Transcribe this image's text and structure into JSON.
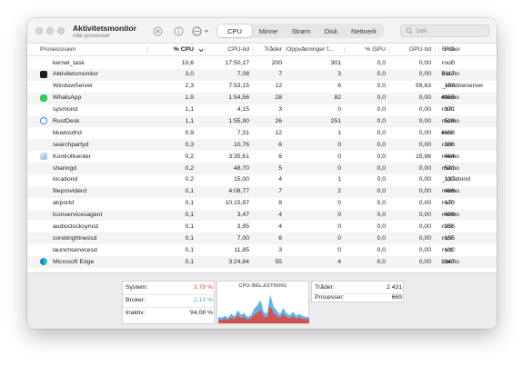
{
  "window": {
    "title": "Aktivitetsmonitor",
    "subtitle": "Alle prosesser"
  },
  "toolbar": {
    "stop_icon": "x-circle-icon",
    "info_icon": "info-icon",
    "more_icon": "ellipsis-circle-icon"
  },
  "tabs": [
    {
      "label": "CPU",
      "active": true
    },
    {
      "label": "Minne",
      "active": false
    },
    {
      "label": "Strøm",
      "active": false
    },
    {
      "label": "Disk",
      "active": false
    },
    {
      "label": "Nettverk",
      "active": false
    }
  ],
  "search": {
    "placeholder": "Søk",
    "value": ""
  },
  "columns": {
    "name": "Prosessnavn",
    "cpu": "% CPU",
    "cpu_time": "CPU-tid",
    "threads": "Tråder",
    "wakeups": "Oppvåkninger f...",
    "gpu": "% GPU",
    "gpu_time": "GPU-tid",
    "pid": "PID",
    "user": "Bruker"
  },
  "processes": [
    {
      "name": "kernel_task",
      "icon": "",
      "cpu": "10,6",
      "cpu_time": "17:50,17",
      "threads": "200",
      "wakeups": "301",
      "gpu": "0,0",
      "gpu_time": "0,00",
      "pid": "0",
      "user": "root"
    },
    {
      "name": "Aktivitetsmonitor",
      "icon": "activity-monitor-app-icon",
      "cpu": "3,0",
      "cpu_time": "7,08",
      "threads": "7",
      "wakeups": "3",
      "gpu": "0,0",
      "gpu_time": "0,00",
      "pid": "5117",
      "user": "memo"
    },
    {
      "name": "WindowServer",
      "icon": "",
      "cpu": "2,3",
      "cpu_time": "7:53,15",
      "threads": "12",
      "wakeups": "6",
      "gpu": "0,0",
      "gpu_time": "59,63",
      "pid": "159",
      "user": "_windowserver"
    },
    {
      "name": "WhatsApp",
      "icon": "whatsapp-app-icon",
      "cpu": "1,9",
      "cpu_time": "1:54,56",
      "threads": "28",
      "wakeups": "82",
      "gpu": "0,0",
      "gpu_time": "0,00",
      "pid": "4955",
      "user": "memo"
    },
    {
      "name": "sysmond",
      "icon": "",
      "cpu": "1,1",
      "cpu_time": "4,15",
      "threads": "3",
      "wakeups": "0",
      "gpu": "0,0",
      "gpu_time": "0,00",
      "pid": "371",
      "user": "root"
    },
    {
      "name": "RustDesk",
      "icon": "rustdesk-app-icon",
      "cpu": "1,1",
      "cpu_time": "1:55,90",
      "threads": "26",
      "wakeups": "251",
      "gpu": "0,0",
      "gpu_time": "0,00",
      "pid": "528",
      "user": "memo"
    },
    {
      "name": "bluetoothd",
      "icon": "",
      "cpu": "0,9",
      "cpu_time": "7,31",
      "threads": "12",
      "wakeups": "1",
      "gpu": "0,0",
      "gpu_time": "0,00",
      "pid": "4668",
      "user": "root"
    },
    {
      "name": "searchpartyd",
      "icon": "",
      "cpu": "0,3",
      "cpu_time": "10,76",
      "threads": "6",
      "wakeups": "0",
      "gpu": "0,0",
      "gpu_time": "0,00",
      "pid": "286",
      "user": "root"
    },
    {
      "name": "Kontrollsenter",
      "icon": "control-center-app-icon",
      "cpu": "0,2",
      "cpu_time": "3:35,61",
      "threads": "6",
      "wakeups": "0",
      "gpu": "0,0",
      "gpu_time": "15,96",
      "pid": "464",
      "user": "memo"
    },
    {
      "name": "sharingd",
      "icon": "",
      "cpu": "0,2",
      "cpu_time": "48,70",
      "threads": "5",
      "wakeups": "0",
      "gpu": "0,0",
      "gpu_time": "0,00",
      "pid": "531",
      "user": "memo"
    },
    {
      "name": "locationd",
      "icon": "",
      "cpu": "0,2",
      "cpu_time": "15,00",
      "threads": "4",
      "wakeups": "1",
      "gpu": "0,0",
      "gpu_time": "0,00",
      "pid": "137",
      "user": "_locationd"
    },
    {
      "name": "fileproviderd",
      "icon": "",
      "cpu": "0,1",
      "cpu_time": "4:08,77",
      "threads": "7",
      "wakeups": "2",
      "gpu": "0,0",
      "gpu_time": "0,00",
      "pid": "486",
      "user": "memo"
    },
    {
      "name": "airportd",
      "icon": "",
      "cpu": "0,1",
      "cpu_time": "10:15,97",
      "threads": "8",
      "wakeups": "0",
      "gpu": "0,0",
      "gpu_time": "0,00",
      "pid": "173",
      "user": "root"
    },
    {
      "name": "lconservicesagent",
      "icon": "",
      "cpu": "0,1",
      "cpu_time": "3,47",
      "threads": "4",
      "wakeups": "0",
      "gpu": "0,0",
      "gpu_time": "0,00",
      "pid": "499",
      "user": "memo"
    },
    {
      "name": "audioclocksyncd",
      "icon": "",
      "cpu": "0,1",
      "cpu_time": "3,95",
      "threads": "4",
      "wakeups": "0",
      "gpu": "0,0",
      "gpu_time": "0,00",
      "pid": "256",
      "user": "root"
    },
    {
      "name": "corebrightnessd",
      "icon": "",
      "cpu": "0,1",
      "cpu_time": "7,00",
      "threads": "6",
      "wakeups": "0",
      "gpu": "0,0",
      "gpu_time": "0,00",
      "pid": "155",
      "user": "root"
    },
    {
      "name": "launchservicesd",
      "icon": "",
      "cpu": "0,1",
      "cpu_time": "11,85",
      "threads": "3",
      "wakeups": "0",
      "gpu": "0,0",
      "gpu_time": "0,00",
      "pid": "132",
      "user": "root"
    },
    {
      "name": "Microsoft Edge",
      "icon": "microsoft-edge-app-icon",
      "cpu": "0,1",
      "cpu_time": "3:24,84",
      "threads": "55",
      "wakeups": "4",
      "gpu": "0,0",
      "gpu_time": "0,00",
      "pid": "1347",
      "user": "memo"
    }
  ],
  "summary": {
    "system_label": "System:",
    "system_value": "3,79 %",
    "user_label": "Bruker:",
    "user_value": "2,13 %",
    "idle_label": "Inaktiv:",
    "idle_value": "94,08 %",
    "graph_title": "CPU-BELASTNING",
    "threads_label": "Tråder:",
    "threads_value": "2 431",
    "processes_label": "Prosesser:",
    "processes_value": "669",
    "colors": {
      "system": "#e0453a",
      "user": "#4fa3d9"
    }
  },
  "cpu_load_history": {
    "system": [
      1.2,
      1.0,
      1.4,
      1.1,
      1.8,
      1.3,
      2.4,
      1.6,
      1.9,
      1.2,
      1.5,
      2.6,
      3.2,
      4.1,
      2.0,
      1.8,
      5.2,
      3.1,
      2.4,
      1.7,
      2.8,
      1.9,
      1.6,
      2.2,
      1.5,
      1.8,
      1.4,
      1.3,
      1.2
    ],
    "user": [
      0.8,
      0.7,
      0.9,
      0.6,
      1.1,
      0.8,
      1.6,
      1.0,
      1.2,
      0.7,
      0.9,
      1.8,
      2.3,
      3.0,
      1.4,
      1.1,
      3.6,
      2.0,
      1.5,
      1.0,
      1.9,
      1.2,
      0.9,
      1.3,
      0.8,
      1.1,
      0.8,
      0.7,
      0.6
    ]
  }
}
